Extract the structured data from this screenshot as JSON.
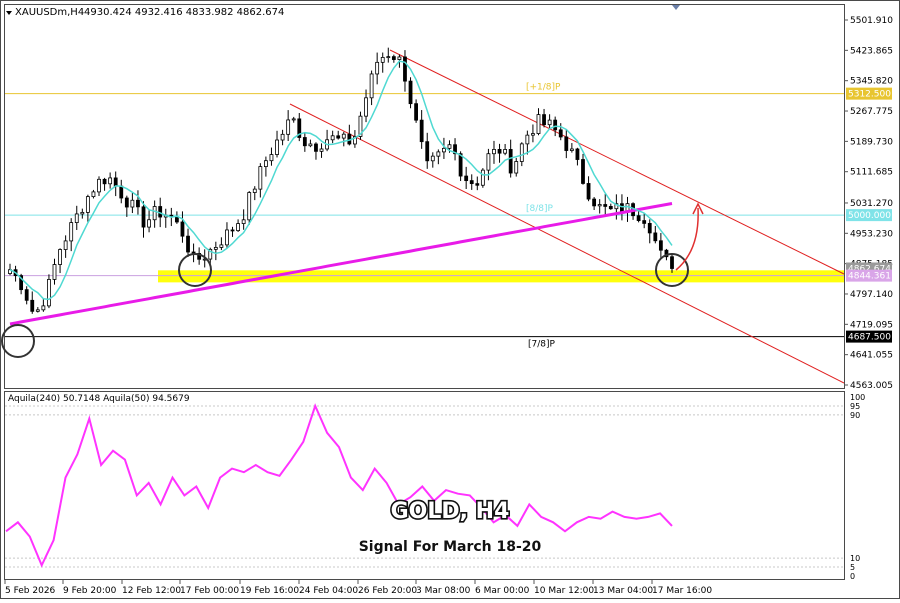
{
  "header": {
    "symbol": "XAUUSDm,H4",
    "ohlc": "4930.424 4932.416 4833.982 4862.674"
  },
  "chart_data": [
    {
      "type": "candlestick",
      "title": "GOLD, H4",
      "subtitle": "Signal For March 18-20",
      "y_ticks": [
        "5501.910",
        "5423.865",
        "5345.820",
        "5267.775",
        "5189.730",
        "5111.685",
        "5031.270",
        "4953.230",
        "4875.185",
        "4797.140",
        "4719.095",
        "4641.055",
        "4563.005"
      ],
      "y_tick_values": [
        5501.91,
        5423.865,
        5345.82,
        5267.775,
        5189.73,
        5111.685,
        5031.27,
        4953.23,
        4875.185,
        4797.14,
        4719.095,
        4641.055,
        4563.005
      ],
      "ylim": [
        4550,
        5530
      ],
      "x_ticks": [
        "5 Feb 2026",
        "9 Feb 20:00",
        "12 Feb 12:00",
        "17 Feb 00:00",
        "19 Feb 16:00",
        "24 Feb 04:00",
        "26 Feb 20:00",
        "3 Mar 08:00",
        "6 Mar 00:00",
        "10 Mar 12:00",
        "13 Mar 04:00",
        "17 Mar 16:00"
      ],
      "horizontal_levels": [
        {
          "label": "[+1/8]P",
          "value": 5312.5,
          "tag": "5312.500",
          "color": "#e8c530"
        },
        {
          "label": "[8/8]P",
          "value": 5000.0,
          "tag": "5000.000",
          "color": "#7fe3e8"
        },
        {
          "label": "[7/8]P",
          "value": 4687.5,
          "tag": "4687.500",
          "color": "#000000"
        }
      ],
      "price_tags": [
        {
          "text": "4862.674",
          "value": 4862.674,
          "color": "#9a9a9a"
        },
        {
          "text": "4844.361",
          "value": 4844.361,
          "color": "#d9a5e8"
        }
      ],
      "support_zone": {
        "from": 4827,
        "to": 4858,
        "color": "#ffff00"
      },
      "series": [
        {
          "name": "moving average (slow)",
          "color": "#e81be8"
        },
        {
          "name": "moving average (fast)",
          "color": "#4fd9d2"
        }
      ],
      "candles_start": [
        4860,
        4820,
        4740,
        4800,
        4910,
        4970,
        5030,
        5080,
        5100,
        5060,
        5020,
        4980,
        5010,
        5000,
        4960,
        4880,
        4900,
        4930,
        4960,
        5000,
        5080,
        5150,
        5200,
        5250,
        5190,
        5180,
        5200,
        5190,
        5190,
        5300,
        5400,
        5420,
        5390,
        5250,
        5120,
        5150,
        5180,
        5100,
        5080,
        5150,
        5170,
        5120,
        5200,
        5240,
        5230,
        5200,
        5150,
        5070,
        5020,
        5010,
        5020,
        5010,
        4990,
        4900,
        4862
      ]
    },
    {
      "type": "line",
      "title": "Aquila(240) 50.7148  Aquila(50) 94.5679",
      "ylim": [
        0,
        100
      ],
      "y_ticks": [
        "100",
        "95",
        "90",
        "10",
        "5",
        "0"
      ],
      "y_tick_values": [
        100,
        95,
        90,
        10,
        5,
        0
      ],
      "series": [
        {
          "name": "Aquila(50)",
          "color": "#ff33ff",
          "values": [
            25,
            30,
            22,
            6,
            20,
            55,
            68,
            88,
            62,
            70,
            65,
            45,
            52,
            40,
            55,
            45,
            50,
            38,
            55,
            60,
            58,
            62,
            58,
            56,
            65,
            75,
            95,
            80,
            72,
            55,
            48,
            60,
            52,
            40,
            44,
            50,
            42,
            48,
            46,
            45,
            38,
            30,
            34,
            28,
            40,
            33,
            30,
            25,
            30,
            33,
            32,
            36,
            33,
            32,
            33,
            35,
            28
          ]
        }
      ]
    }
  ]
}
